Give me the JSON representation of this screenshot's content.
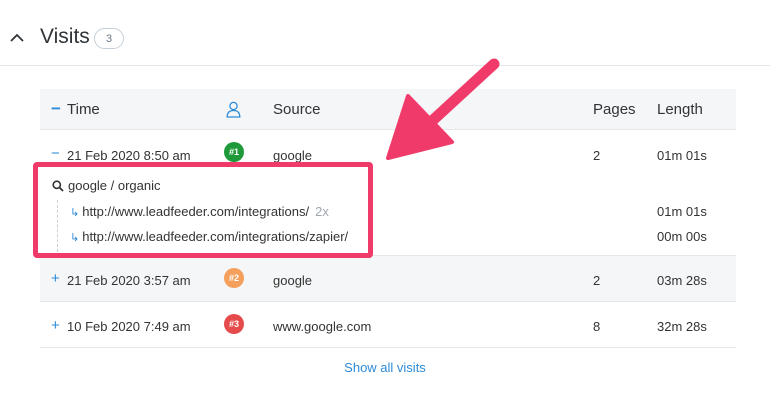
{
  "section": {
    "title": "Visits",
    "count": "3"
  },
  "columns": {
    "time": "Time",
    "source": "Source",
    "pages": "Pages",
    "length": "Length"
  },
  "rows": [
    {
      "toggle": "−",
      "time": "21 Feb 2020 8:50 am",
      "rank": "#1",
      "rank_color": "#1f9a3a",
      "source": "google",
      "pages": "2",
      "length": "01m 01s"
    },
    {
      "toggle": "+",
      "time": "21 Feb 2020 3:57 am",
      "rank": "#2",
      "rank_color": "#f4a05c",
      "source": "google",
      "pages": "2",
      "length": "03m 28s"
    },
    {
      "toggle": "+",
      "time": "10 Feb 2020 7:49 am",
      "rank": "#3",
      "rank_color": "#e54b4b",
      "source": "www.google.com",
      "pages": "8",
      "length": "32m 28s"
    }
  ],
  "expanded": {
    "query": "google / organic",
    "pages": [
      {
        "url": "http://www.leadfeeder.com/integrations/",
        "times": "2x",
        "length": "01m 01s"
      },
      {
        "url": "http://www.leadfeeder.com/integrations/zapier/",
        "times": "",
        "length": "00m 00s"
      }
    ]
  },
  "footer": {
    "show_all": "Show all visits"
  },
  "colors": {
    "accent": "#2e8bd8",
    "highlight": "#f03a6a"
  }
}
